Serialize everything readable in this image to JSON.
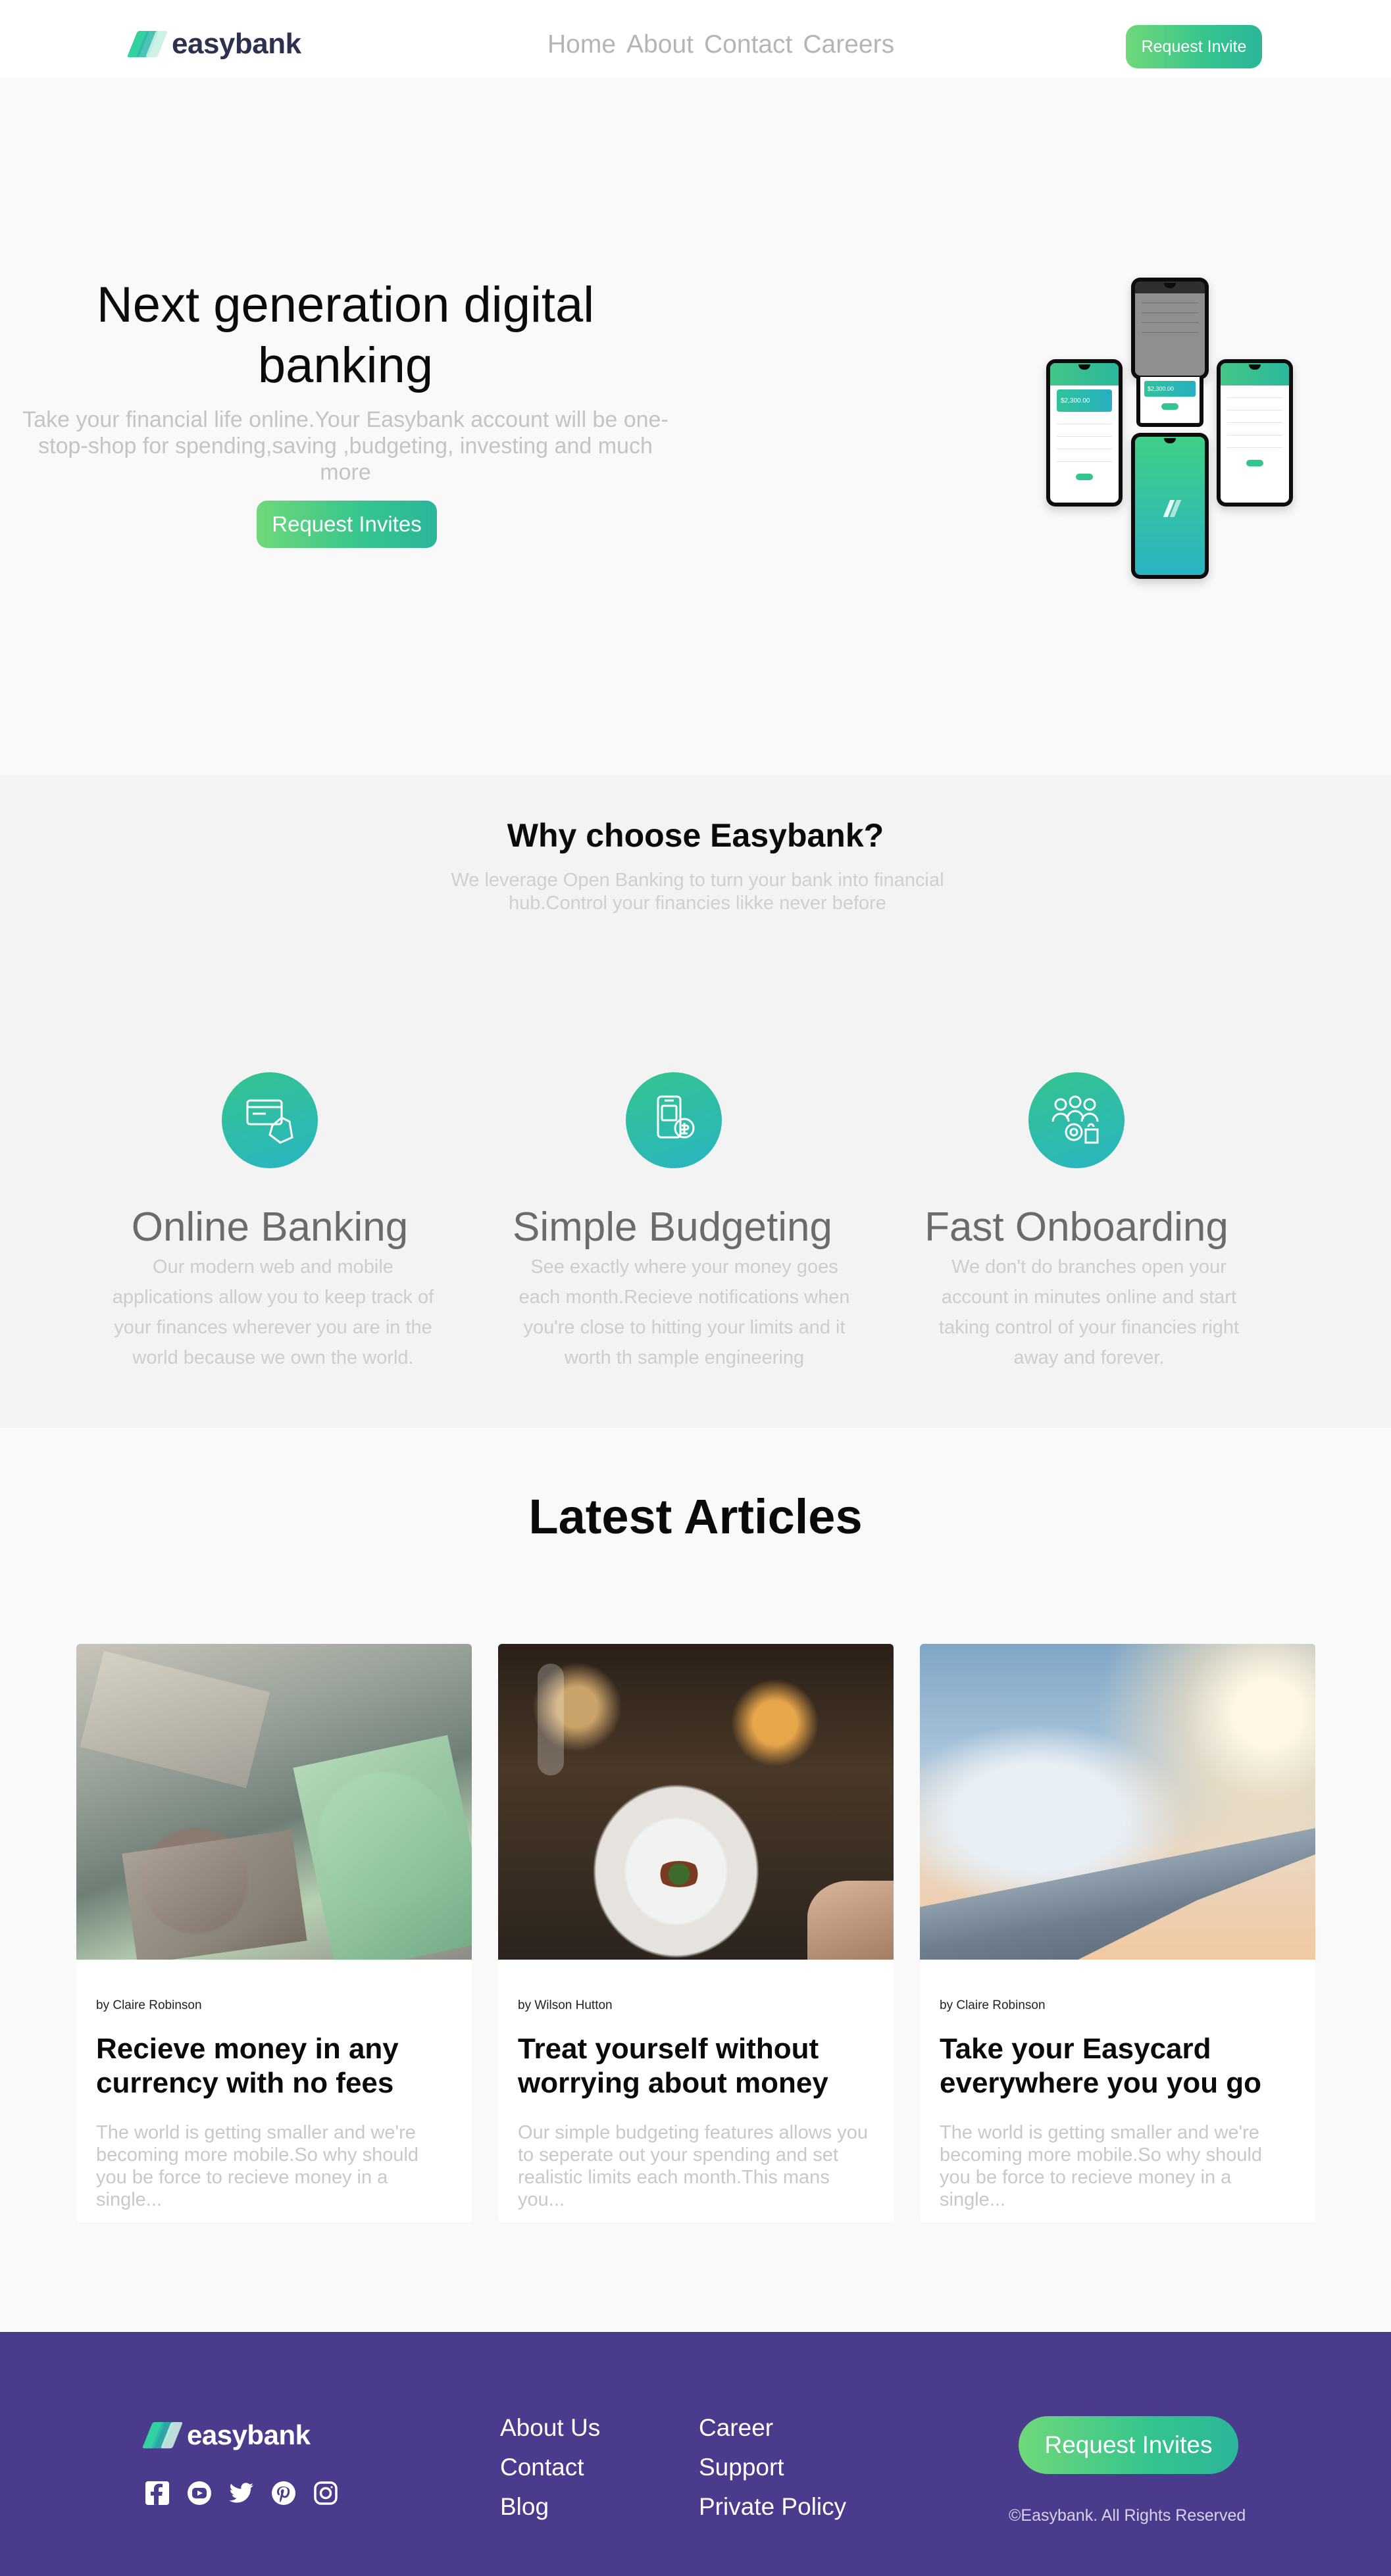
{
  "brand": {
    "name": "easybank",
    "colors": {
      "primary": "#2d314d",
      "accent_green": "#34c48e",
      "accent_teal": "#29b5c3",
      "footer_bg": "#4a3b8c"
    }
  },
  "header": {
    "nav": [
      "Home",
      "About",
      "Contact",
      "Careers"
    ],
    "cta_label": "Request Invite"
  },
  "hero": {
    "title": "Next generation digital banking",
    "subtitle": "Take your financial life online.Your Easybank account will be one-stop-shop for spending,saving ,budgeting, investing and much more",
    "cta_label": "Request Invites",
    "mockup_amounts": [
      "$2,300.00",
      "$2,300.00"
    ]
  },
  "why": {
    "title": "Why choose Easybank?",
    "subtitle": "We leverage Open Banking to turn your bank into financial hub.Control your financies likke never before",
    "features": [
      {
        "icon": "card-payment-icon",
        "title": "Online Banking",
        "text": "Our modern web and mobile applications allow you to keep track of your finances wherever you are in the world because we own the world."
      },
      {
        "icon": "mobile-budget-icon",
        "title": "Simple Budgeting",
        "text": "See exactly where your money goes each month.Recieve notifications when you're close to hitting your limits and it worth th sample engineering"
      },
      {
        "icon": "team-onboarding-icon",
        "title": "Fast Onboarding",
        "text": "We don't do branches open your account in minutes online and start taking control of your financies right away and forever."
      }
    ]
  },
  "articles": {
    "heading": "Latest Articles",
    "items": [
      {
        "image": "currency-banknotes-image",
        "author": "by Claire Robinson",
        "title": "Recieve money in any currency with no fees",
        "excerpt": "The world is getting smaller and we're becoming more mobile.So why should you be force to recieve money in a single..."
      },
      {
        "image": "restaurant-dinner-image",
        "author": "by Wilson Hutton",
        "title": "Treat yourself without worrying about money",
        "excerpt": "Our simple budgeting features allows you to seperate out your spending and set realistic limits each month.This mans you..."
      },
      {
        "image": "airplane-wing-image",
        "author": "by Claire Robinson",
        "title": "Take your Easycard everywhere you you go",
        "excerpt": "The world is getting smaller and we're becoming more mobile.So why should you be force to recieve money in a single..."
      }
    ]
  },
  "footer": {
    "brand": "easybank",
    "socials": [
      "facebook-icon",
      "youtube-icon",
      "twitter-icon",
      "pinterest-icon",
      "instagram-icon"
    ],
    "links_col1": [
      "About Us",
      "Contact",
      "Blog"
    ],
    "links_col2": [
      "Career",
      "Support",
      "Private Policy"
    ],
    "cta_label": "Request Invites",
    "copyright": "©Easybank. All Rights Reserved"
  }
}
